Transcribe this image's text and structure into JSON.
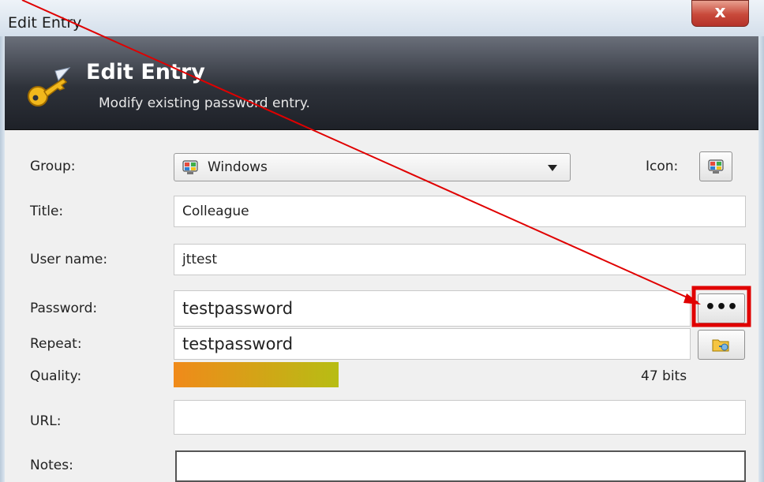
{
  "window": {
    "title": "Edit Entry",
    "close_label": "x"
  },
  "banner": {
    "title": "Edit Entry",
    "subtitle": "Modify existing password entry."
  },
  "form": {
    "group_label": "Group:",
    "group_value": "Windows",
    "icon_label": "Icon:",
    "title_label": "Title:",
    "title_value": "Colleague",
    "username_label": "User name:",
    "username_value": "jttest",
    "password_label": "Password:",
    "password_value": "testpassword",
    "password_toggle_label": "•••",
    "repeat_label": "Repeat:",
    "repeat_value": "testpassword",
    "quality_label": "Quality:",
    "quality_fraction": 0.5,
    "quality_text": "47 bits",
    "url_label": "URL:",
    "url_value": "",
    "notes_label": "Notes:",
    "notes_value": ""
  },
  "annotation": {
    "arrow_color": "#e00000",
    "highlight_color": "#e00000"
  }
}
